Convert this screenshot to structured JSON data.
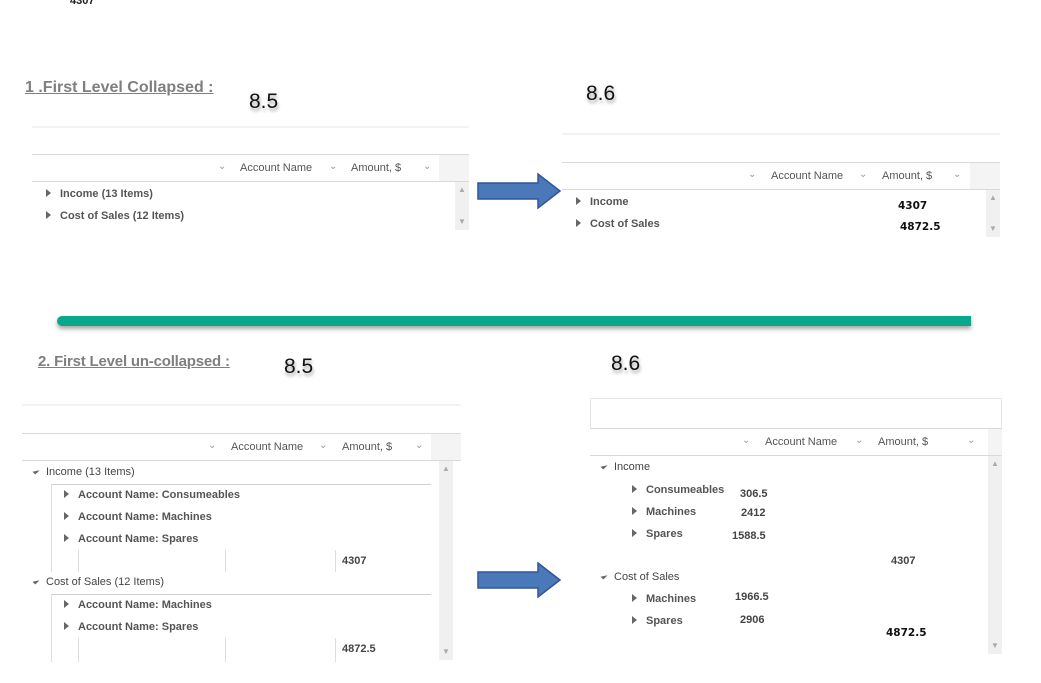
{
  "stray_top_value": "4307",
  "separator_color": "#0aa88a",
  "arrow_color": "#4a78b8",
  "section1": {
    "title": "1 .First Level Collapsed :",
    "before": {
      "version": "8.5",
      "columns": [
        "Account Name",
        "Amount, $"
      ],
      "rows": [
        {
          "label": "Income (13 Items)",
          "state": "collapsed"
        },
        {
          "label": "Cost of Sales (12 Items)",
          "state": "collapsed"
        }
      ]
    },
    "after": {
      "version": "8.6",
      "columns": [
        "Account Name",
        "Amount, $"
      ],
      "rows": [
        {
          "label": "Income",
          "state": "collapsed",
          "total": "4307"
        },
        {
          "label": "Cost of Sales",
          "state": "collapsed",
          "total": "4872.5"
        }
      ]
    }
  },
  "section2": {
    "title": "2. First Level un-collapsed :",
    "before": {
      "version": "8.5",
      "columns": [
        "Account Name",
        "Amount, $"
      ],
      "groups": [
        {
          "label": "Income (13 Items)",
          "state": "expanded",
          "children": [
            "Account Name: Consumeables",
            "Account Name: Machines",
            "Account Name: Spares"
          ],
          "total": "4307"
        },
        {
          "label": "Cost of Sales (12 Items)",
          "state": "expanded",
          "children": [
            "Account Name: Machines",
            "Account Name: Spares"
          ],
          "total": "4872.5"
        }
      ]
    },
    "after": {
      "version": "8.6",
      "columns": [
        "Account Name",
        "Amount, $"
      ],
      "groups": [
        {
          "label": "Income",
          "state": "expanded",
          "children": [
            {
              "label": "Consumeables",
              "amount": "306.5"
            },
            {
              "label": "Machines",
              "amount": "2412"
            },
            {
              "label": "Spares",
              "amount": "1588.5"
            }
          ],
          "total": "4307"
        },
        {
          "label": "Cost of Sales",
          "state": "expanded",
          "children": [
            {
              "label": "Machines",
              "amount": "1966.5"
            },
            {
              "label": "Spares",
              "amount": "2906"
            }
          ],
          "total": "4872.5"
        }
      ]
    }
  }
}
